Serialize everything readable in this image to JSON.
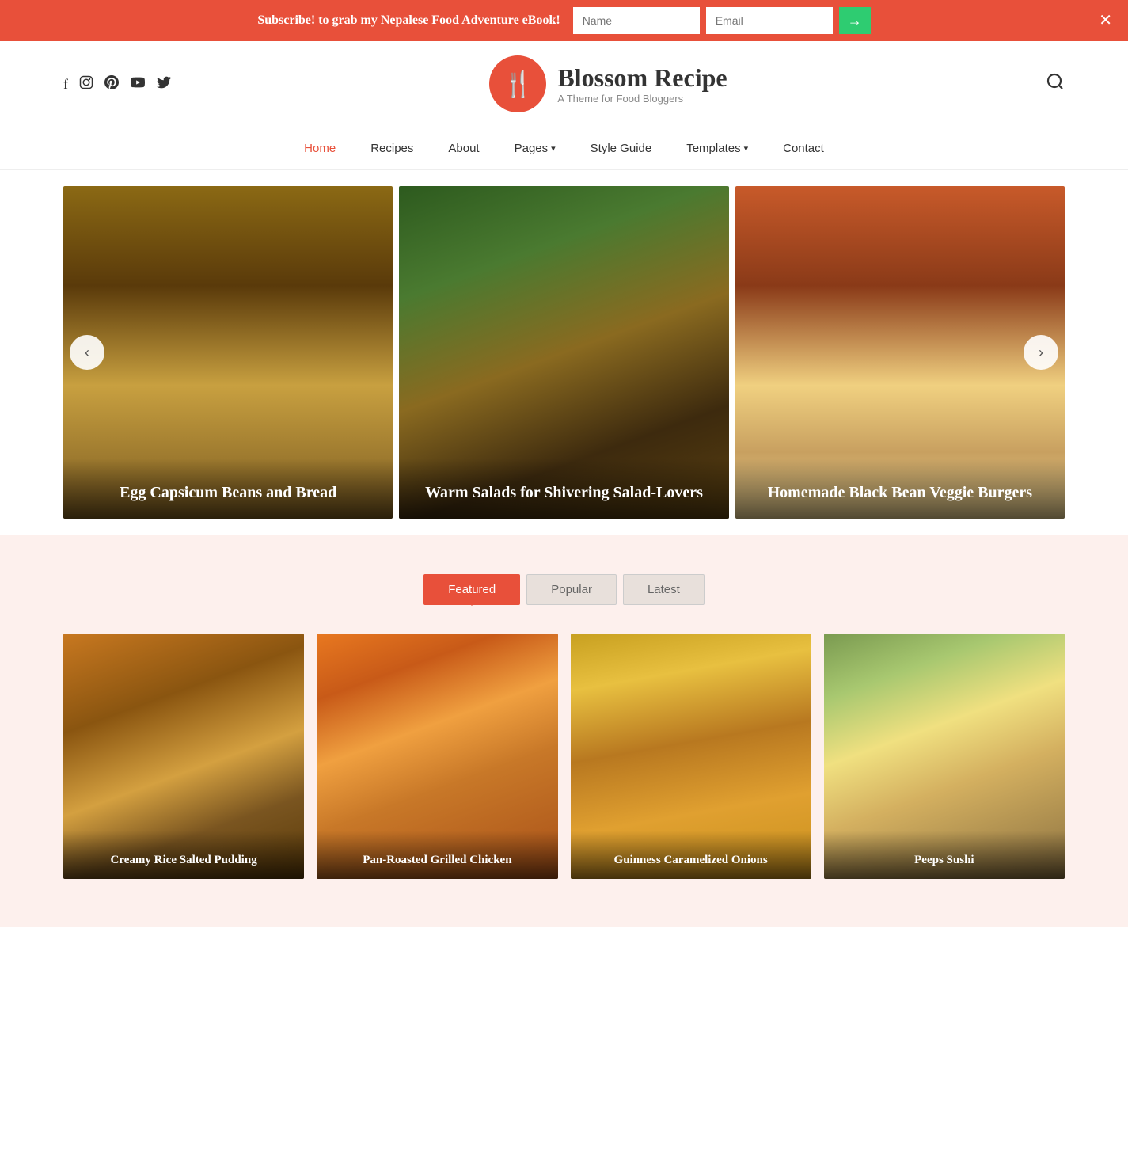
{
  "announce": {
    "text": "Subscribe! to grab my Nepalese Food Adventure eBook!",
    "name_placeholder": "Name",
    "email_placeholder": "Email",
    "submit_arrow": "→",
    "close": "✕"
  },
  "header": {
    "logo_alt": "Blossom Recipe",
    "logo_title": "Blossom Recipe",
    "logo_subtitle": "A Theme for Food Bloggers",
    "logo_icon": "🍴",
    "search_icon": "🔍"
  },
  "social": {
    "facebook": "f",
    "instagram": "📷",
    "pinterest": "𝗽",
    "youtube": "▶",
    "twitter": "🐦"
  },
  "nav": {
    "items": [
      {
        "label": "Home",
        "active": true,
        "has_dropdown": false
      },
      {
        "label": "Recipes",
        "active": false,
        "has_dropdown": false
      },
      {
        "label": "About",
        "active": false,
        "has_dropdown": false
      },
      {
        "label": "Pages",
        "active": false,
        "has_dropdown": true
      },
      {
        "label": "Style Guide",
        "active": false,
        "has_dropdown": false
      },
      {
        "label": "Templates",
        "active": false,
        "has_dropdown": true
      },
      {
        "label": "Contact",
        "active": false,
        "has_dropdown": false
      }
    ]
  },
  "slider": {
    "prev_label": "‹",
    "next_label": "›",
    "slides": [
      {
        "title": "Egg Capsicum Beans and Bread"
      },
      {
        "title": "Warm Salads for Shivering Salad-Lovers"
      },
      {
        "title": "Homemade Black Bean Veggie Burgers"
      }
    ]
  },
  "featured": {
    "tabs": [
      {
        "label": "Featured",
        "active": true
      },
      {
        "label": "Popular",
        "active": false
      },
      {
        "label": "Latest",
        "active": false
      }
    ],
    "cards": [
      {
        "title": "Creamy Rice Salted Pudding"
      },
      {
        "title": "Pan-Roasted Grilled Chicken"
      },
      {
        "title": "Guinness Caramelized Onions"
      },
      {
        "title": "Peeps Sushi"
      }
    ]
  }
}
